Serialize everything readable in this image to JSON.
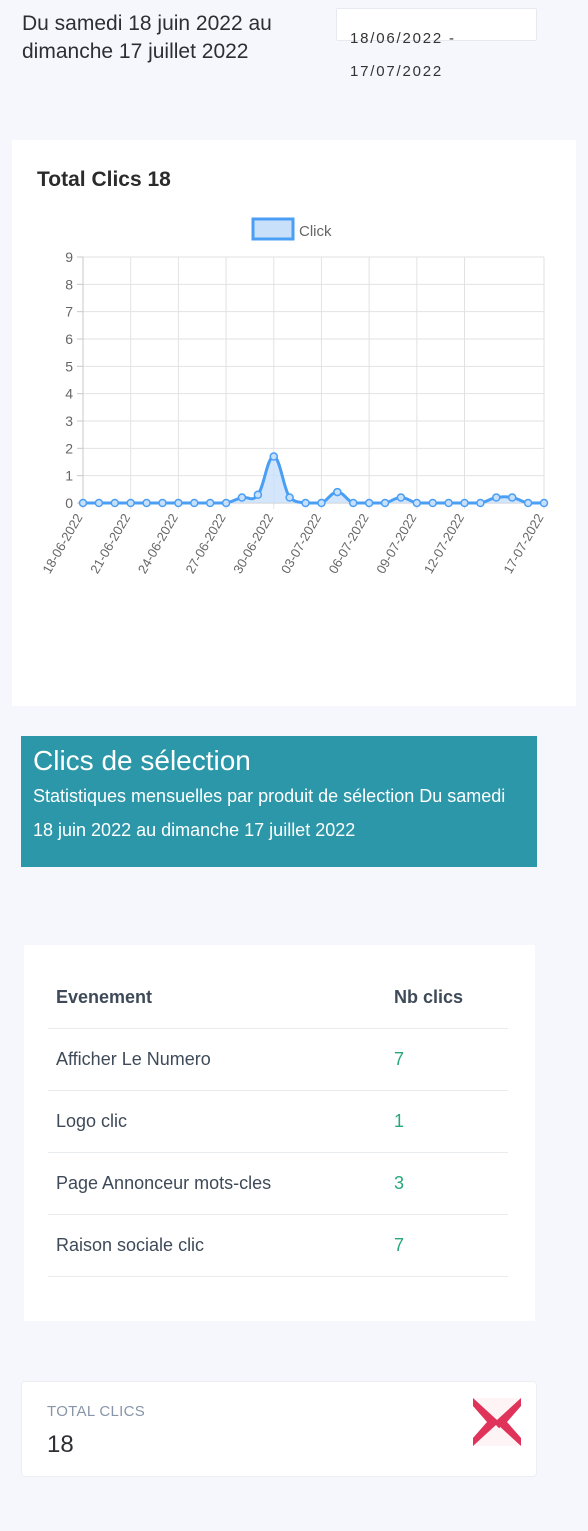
{
  "header": {
    "period_title": "Du samedi 18 juin 2022 au dimanche 17 juillet 2022",
    "date_range": "18/06/2022 - 17/07/2022"
  },
  "chart_card": {
    "title": "Total Clics 18"
  },
  "chart_data": {
    "type": "line",
    "legend": "Click",
    "legend_position": "top",
    "grid": true,
    "ylim": [
      0,
      9
    ],
    "yticks": [
      "0",
      "1",
      "2",
      "3",
      "4",
      "5",
      "6",
      "7",
      "8",
      "9"
    ],
    "x_tick_labels": [
      "18-06-2022",
      "21-06-2022",
      "24-06-2022",
      "27-06-2022",
      "30-06-2022",
      "03-07-2022",
      "06-07-2022",
      "09-07-2022",
      "12-07-2022",
      "17-07-2022"
    ],
    "x": [
      "18-06-2022",
      "19-06-2022",
      "20-06-2022",
      "21-06-2022",
      "22-06-2022",
      "23-06-2022",
      "24-06-2022",
      "25-06-2022",
      "26-06-2022",
      "27-06-2022",
      "28-06-2022",
      "29-06-2022",
      "30-06-2022",
      "01-07-2022",
      "02-07-2022",
      "03-07-2022",
      "04-07-2022",
      "05-07-2022",
      "06-07-2022",
      "07-07-2022",
      "08-07-2022",
      "09-07-2022",
      "10-07-2022",
      "11-07-2022",
      "12-07-2022",
      "13-07-2022",
      "14-07-2022",
      "15-07-2022",
      "16-07-2022",
      "17-07-2022"
    ],
    "values": [
      0,
      0,
      0,
      0,
      0,
      0,
      0,
      0,
      0,
      0,
      0.2,
      0.3,
      1.7,
      0.2,
      0,
      0,
      0.4,
      0,
      0,
      0,
      0.2,
      0,
      0,
      0,
      0,
      0,
      0.2,
      0.2,
      0,
      0
    ],
    "line_color": "#4a9ff5",
    "fill_color": "#c9e0fb"
  },
  "selection": {
    "title": "Clics de sélection",
    "subtitle": "Statistiques mensuelles par produit de sélection Du samedi 18 juin 2022 au dimanche 17 juillet 2022"
  },
  "table": {
    "headers": [
      "Evenement",
      "Nb clics"
    ],
    "rows": [
      {
        "name": "Afficher Le Numero",
        "value": "7"
      },
      {
        "name": "Logo clic",
        "value": "1"
      },
      {
        "name": "Page Annonceur mots-cles",
        "value": "3"
      },
      {
        "name": "Raison sociale clic",
        "value": "7"
      }
    ]
  },
  "total": {
    "label": "TOTAL CLICS",
    "value": "18",
    "icon": "chart-icon",
    "icon_color": "#e0335a"
  }
}
